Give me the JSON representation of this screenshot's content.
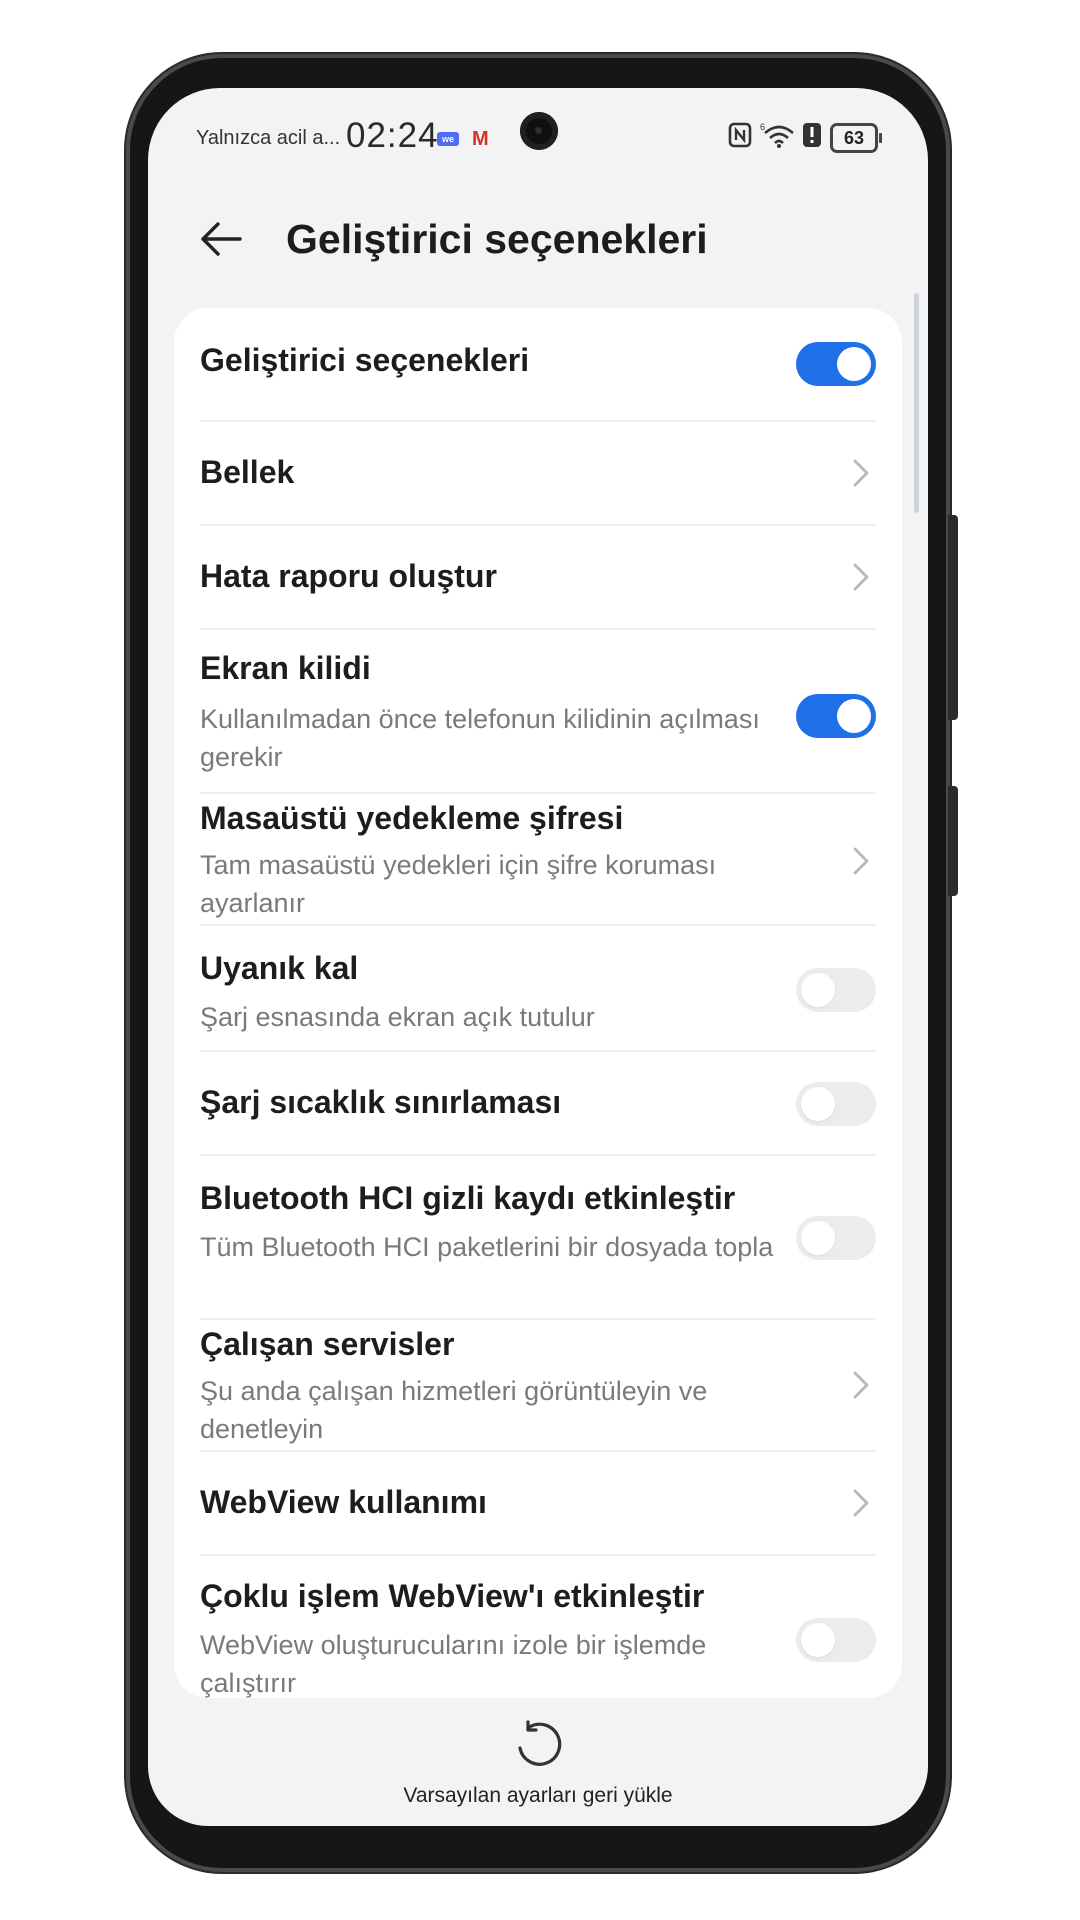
{
  "status_bar": {
    "carrier_text": "Yalnızca acil a...",
    "time": "02:24",
    "battery_level": "63",
    "icons": [
      "app-notification-icon",
      "gmail-icon",
      "nfc-icon",
      "wifi-icon",
      "alert-icon",
      "battery-icon"
    ]
  },
  "header": {
    "back_icon": "arrow-left-icon",
    "title": "Geliştirici seçenekleri"
  },
  "settings": {
    "items": [
      {
        "label": "Geliştirici seçenekleri",
        "subtitle": "",
        "control": "toggle",
        "state": true
      },
      {
        "label": "Bellek",
        "subtitle": "",
        "control": "chevron"
      },
      {
        "label": "Hata raporu oluştur",
        "subtitle": "",
        "control": "chevron"
      },
      {
        "label": "Ekran kilidi",
        "subtitle": "Kullanılmadan önce telefonun kilidinin açılması gerekir",
        "control": "toggle",
        "state": true
      },
      {
        "label": "Masaüstü yedekleme şifresi",
        "subtitle": "Tam masaüstü yedekleri için şifre koruması ayarlanır",
        "control": "chevron"
      },
      {
        "label": "Uyanık kal",
        "subtitle": "Şarj esnasında ekran açık tutulur",
        "control": "toggle",
        "state": false
      },
      {
        "label": "Şarj sıcaklık sınırlaması",
        "subtitle": "",
        "control": "toggle",
        "state": false
      },
      {
        "label": "Bluetooth HCI gizli kaydı etkinleştir",
        "subtitle": "Tüm Bluetooth HCI paketlerini bir dosyada topla",
        "control": "toggle",
        "state": false
      },
      {
        "label": "Çalışan servisler",
        "subtitle": "Şu anda çalışan hizmetleri görüntüleyin ve denetleyin",
        "control": "chevron"
      },
      {
        "label": "WebView kullanımı",
        "subtitle": "",
        "control": "chevron"
      },
      {
        "label": "Çoklu işlem WebView'ı etkinleştir",
        "subtitle": "WebView oluşturucularını izole bir işlemde çalıştırır",
        "control": "toggle",
        "state": false
      }
    ]
  },
  "footer": {
    "reset_icon": "restore-icon",
    "reset_label": "Varsayılan ayarları geri yükle"
  },
  "colors": {
    "accent": "#1f6fe8",
    "background": "#f1f3f5",
    "card": "#ffffff"
  }
}
